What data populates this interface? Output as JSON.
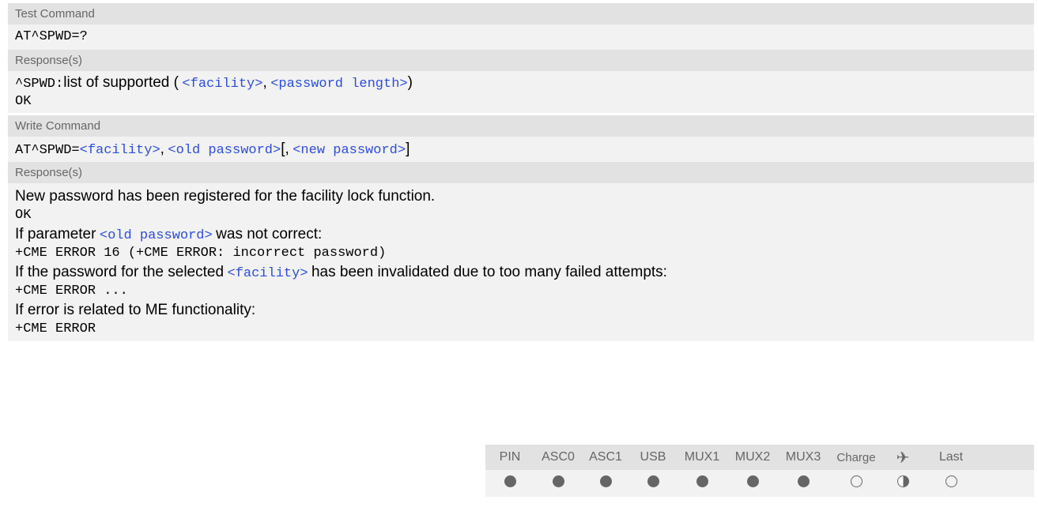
{
  "test_command": {
    "label": "Test Command",
    "command": "AT^SPWD=?",
    "response_label": "Response(s)",
    "response_prefix": "^SPWD:",
    "response_text": "list of supported (",
    "param_facility": "<facility>",
    "sep1": ",",
    "param_password_length": "<password length>",
    "close": ")",
    "ok": "OK"
  },
  "write_command": {
    "label": "Write Command",
    "cmd_prefix": "AT^SPWD=",
    "param_facility": "<facility>",
    "sep1": ",",
    "param_old_password": "<old password>",
    "bracket_open": "[,",
    "param_new_password": "<new password>",
    "bracket_close": "]",
    "response_label": "Response(s)",
    "line1": "New password has been registered for the facility lock function.",
    "ok": "OK",
    "if1_prefix": "If parameter",
    "if1_param": "<old password>",
    "if1_suffix": "was not correct:",
    "err1": "+CME ERROR 16 (+CME ERROR: incorrect password)",
    "if2_prefix": "If the password for the selected",
    "if2_param": "<facility>",
    "if2_suffix": "has been invalidated due to too many failed attempts:",
    "err2": "+CME ERROR ...",
    "if3": "If error is related to ME functionality:",
    "err3": "+CME ERROR"
  },
  "interfaces": {
    "headers": [
      "PIN",
      "ASC0",
      "ASC1",
      "USB",
      "MUX1",
      "MUX2",
      "MUX3",
      "Charge",
      "✈",
      "Last"
    ],
    "states": [
      "full",
      "full",
      "full",
      "full",
      "full",
      "full",
      "full",
      "empty",
      "half",
      "empty"
    ]
  }
}
